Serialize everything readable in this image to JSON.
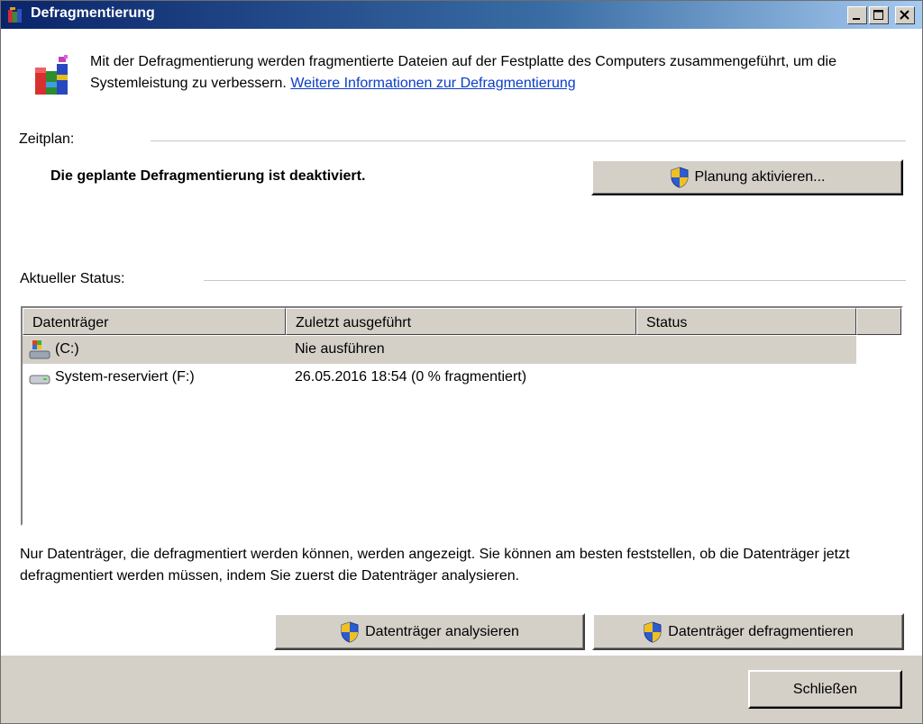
{
  "window": {
    "title": "Defragmentierung",
    "icon": "defrag-app-icon"
  },
  "intro": {
    "text": "Mit der Defragmentierung werden fragmentierte Dateien auf der Festplatte des Computers zusammengeführt, um die Systemleistung zu verbessern.",
    "link": "Weitere Informationen zur Defragmentierung"
  },
  "schedule": {
    "label": "Zeitplan:",
    "status": "Die geplante Defragmentierung ist deaktiviert.",
    "button": "Planung aktivieren..."
  },
  "status": {
    "label": "Aktueller Status:",
    "columns": [
      "Datenträger",
      "Zuletzt ausgeführt",
      "Status"
    ],
    "rows": [
      {
        "drive": "(C:)",
        "last_run": "Nie ausführen",
        "status": "",
        "icon": "system-drive-icon",
        "selected": true
      },
      {
        "drive": "System-reserviert (F:)",
        "last_run": "26.05.2016 18:54 (0 % fragmentiert)",
        "status": "",
        "icon": "hard-drive-icon",
        "selected": false
      }
    ]
  },
  "note": "Nur Datenträger, die defragmentiert werden können, werden angezeigt. Sie können am besten feststellen, ob die Datenträger jetzt defragmentiert werden müssen, indem Sie zuerst die Datenträger analysieren.",
  "actions": {
    "analyze": "Datenträger analysieren",
    "defragment": "Datenträger defragmentieren",
    "close": "Schließen"
  },
  "colors": {
    "title_gradient_start": "#0a246a",
    "title_gradient_end": "#a6caf0",
    "link": "#0a3cc8",
    "face": "#d4d0c8"
  }
}
